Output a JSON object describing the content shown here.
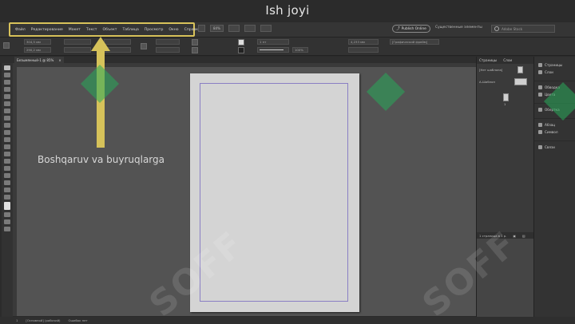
{
  "slide_title": "Ish joyi",
  "annotation": "Boshqaruv va buyruqlarga",
  "watermark": "SOFF",
  "menu": {
    "items": [
      "Файл",
      "Редактирование",
      "Макет",
      "Текст",
      "Объект",
      "Таблица",
      "Просмотр",
      "Окно",
      "Справка"
    ]
  },
  "menu_controls": {
    "zoom": "84%",
    "publish_label": "Publish Online",
    "workspace": "Существенные элементы",
    "search_placeholder": "Adobe Stock"
  },
  "control_bar": {
    "x_value": "304,5 мм",
    "y_value": "290,2 мм",
    "stroke_weight": "1 пт",
    "opacity": "100%",
    "measure": "4,233 мм",
    "frame_style": "[Графический фрейм]"
  },
  "document_tab": {
    "title": "Безымянный-1 @ 85%"
  },
  "pages_panel": {
    "title": "Страницы",
    "tab2": "Слои",
    "none_label": "[Нет шаблона]",
    "master_label": "А-Шаблон",
    "page_number": "1",
    "footer": "1 страница в 1 р."
  },
  "dock": {
    "items": [
      {
        "label": "Страницы",
        "icon": "pages-icon"
      },
      {
        "label": "Слои",
        "icon": "layers-icon"
      },
      {
        "label": "Обводка",
        "icon": "stroke-icon"
      },
      {
        "label": "Цвета",
        "icon": "swatches-icon"
      },
      {
        "label": "Оберткa",
        "icon": "wrap-icon"
      },
      {
        "label": "Абзац",
        "icon": "paragraph-icon"
      },
      {
        "label": "Символ",
        "icon": "character-icon"
      },
      {
        "label": "Связи",
        "icon": "links-icon"
      }
    ]
  },
  "status": {
    "page": "1",
    "state": "[Основной] (рабочий)",
    "errors": "Ошибок нет"
  },
  "colors": {
    "highlight": "#d8c25a",
    "page": "#d4d4d4",
    "pasteboard": "#535353"
  }
}
